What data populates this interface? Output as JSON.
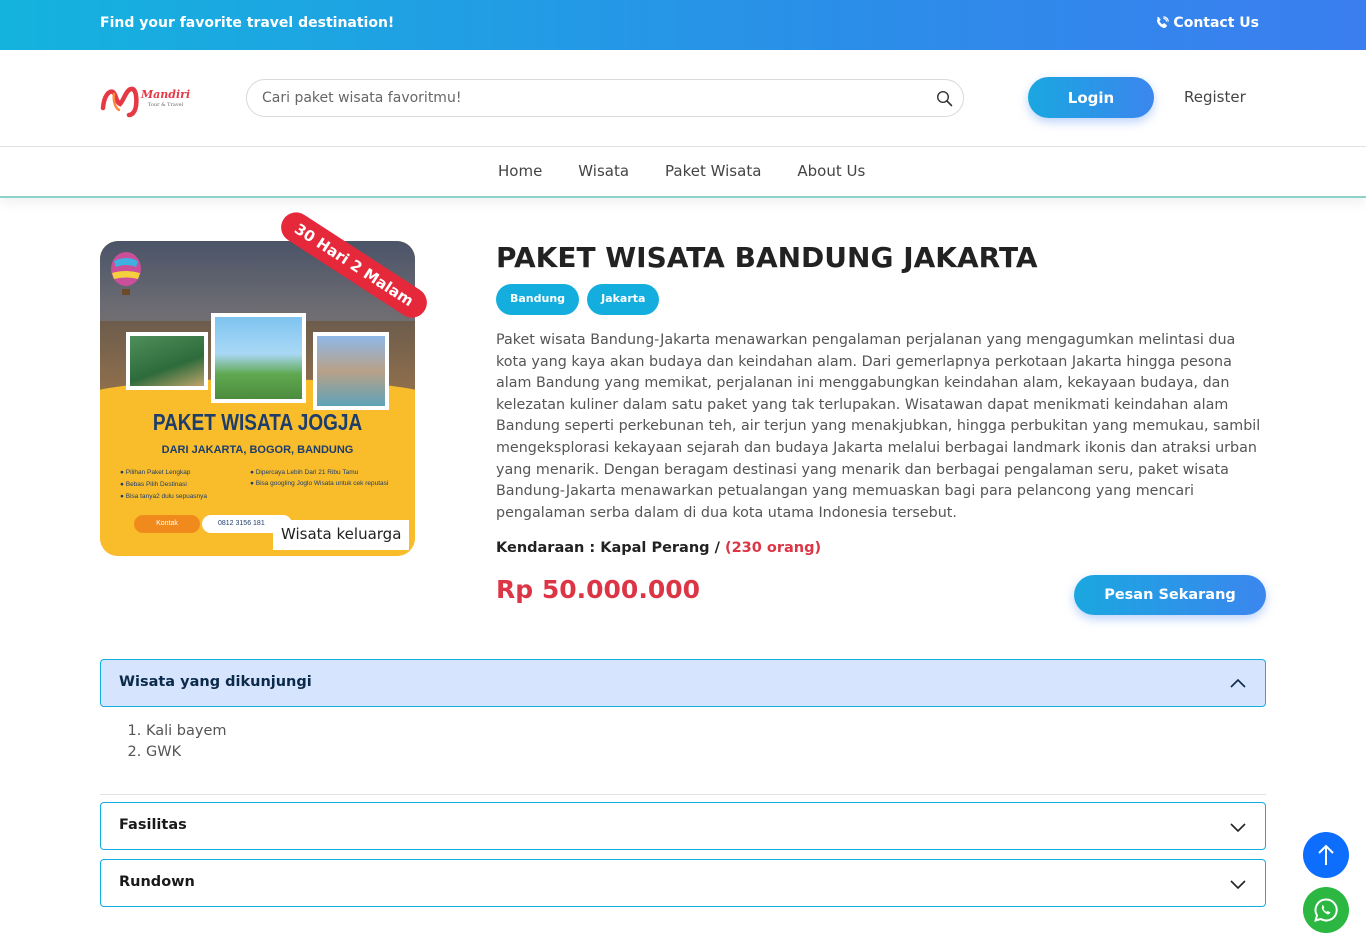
{
  "topbar": {
    "tagline": "Find your favorite travel destination!",
    "contact_label": "Contact Us"
  },
  "header": {
    "logo_text": "Mandiri",
    "logo_subtext": "Tour & Travel",
    "search_placeholder": "Cari paket wisata favoritmu!",
    "login_label": "Login",
    "register_label": "Register"
  },
  "nav": {
    "items": [
      "Home",
      "Wisata",
      "Paket Wisata",
      "About Us"
    ]
  },
  "product": {
    "duration_ribbon": "30 Hari 2 Malam",
    "image_caption": "Wisata keluarga",
    "image_text": {
      "title": "PAKET WISATA JOGJA",
      "subtitle": "DARI JAKARTA, BOGOR, BANDUNG",
      "features_left": [
        "Pilihan Paket Lengkap",
        "Bebas Pilih Destinasi",
        "Bisa tanya2 dulu sepuasnya"
      ],
      "features_right": [
        "Dipercaya Lebih Dari 21 Ribu Tamu",
        "Bisa googling Joglo Wisata untuk cek reputasi"
      ],
      "kontak_label": "Kontak",
      "phone": "0812 3156 181"
    },
    "title": "PAKET WISATA BANDUNG JAKARTA",
    "tags": [
      "Bandung",
      "Jakarta"
    ],
    "description": "Paket wisata Bandung-Jakarta menawarkan pengalaman perjalanan yang mengagumkan melintasi dua kota yang kaya akan budaya dan keindahan alam. Dari gemerlapnya perkotaan Jakarta hingga pesona alam Bandung yang memikat, perjalanan ini menggabungkan keindahan alam, kekayaan budaya, dan kelezatan kuliner dalam satu paket yang tak terlupakan. Wisatawan dapat menikmati keindahan alam Bandung seperti perkebunan teh, air terjun yang menakjubkan, hingga perbukitan yang memukau, sambil mengeksplorasi kekayaan sejarah dan budaya Jakarta melalui berbagai landmark ikonis dan atraksi urban yang menarik. Dengan beragam destinasi yang menarik dan berbagai pengalaman seru, paket wisata Bandung-Jakarta menawarkan petualangan yang memuaskan bagi para pelancong yang mencari pengalaman serba dalam di dua kota utama Indonesia tersebut.",
    "vehicle_label": "Kendaraan : Kapal Perang /",
    "capacity": "(230 orang)",
    "price": "Rp 50.000.000",
    "order_label": "Pesan Sekarang"
  },
  "accordion": {
    "visited": {
      "label": "Wisata yang dikunjungi",
      "items": [
        "Kali bayem",
        "GWK"
      ]
    },
    "facilities": {
      "label": "Fasilitas"
    },
    "rundown": {
      "label": "Rundown"
    }
  },
  "colors": {
    "primary": "#14aede",
    "accent_red": "#dc3545",
    "whatsapp": "#2cb742",
    "scroll_top": "#0d6efd"
  }
}
